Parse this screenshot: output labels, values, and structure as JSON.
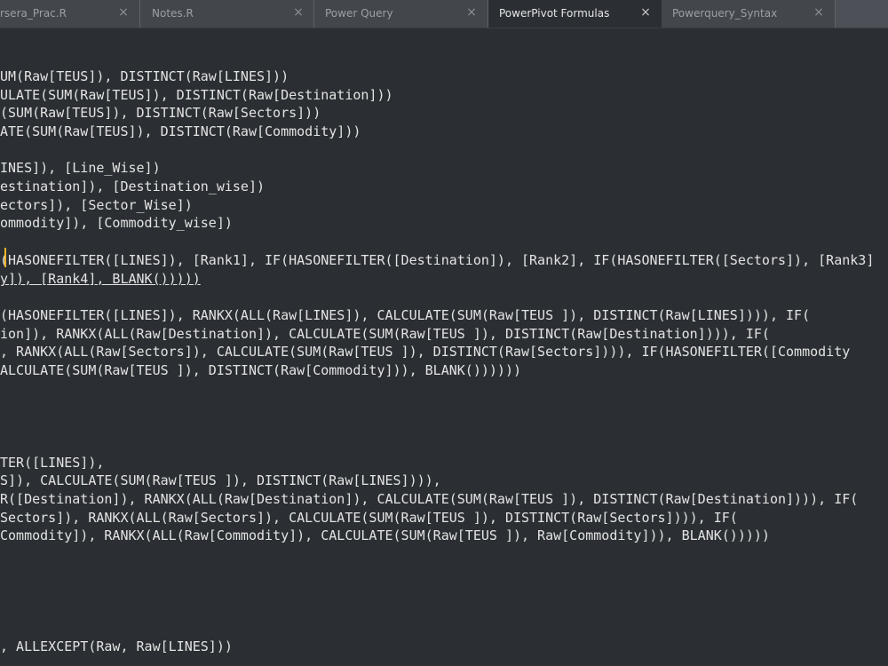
{
  "tabs": [
    {
      "label": "rsera_Prac.R",
      "close": "×",
      "active": false
    },
    {
      "label": "Notes.R",
      "close": "×",
      "active": false
    },
    {
      "label": "Power Query",
      "close": "×",
      "active": false
    },
    {
      "label": "PowerPivot Formulas",
      "close": "×",
      "active": true
    },
    {
      "label": "Powerquery_Syntax",
      "close": "×",
      "active": false
    }
  ],
  "editor": {
    "lines": [
      "UM(Raw[TEUS]), DISTINCT(Raw[LINES]))",
      "ULATE(SUM(Raw[TEUS]), DISTINCT(Raw[Destination]))",
      "(SUM(Raw[TEUS]), DISTINCT(Raw[Sectors]))",
      "ATE(SUM(Raw[TEUS]), DISTINCT(Raw[Commodity]))",
      "",
      "INES]), [Line_Wise])",
      "estination]), [Destination_wise])",
      "ectors]), [Sector_Wise])",
      "ommodity]), [Commodity_wise])",
      "",
      "(HASONEFILTER([LINES]), [Rank1], IF(HASONEFILTER([Destination]), [Rank2], IF(HASONEFILTER([Sectors]), [Rank3]",
      "y]), [Rank4], BLANK()))))",
      "",
      "(HASONEFILTER([LINES]), RANKX(ALL(Raw[LINES]), CALCULATE(SUM(Raw[TEUS ]), DISTINCT(Raw[LINES]))), IF(",
      "ion]), RANKX(ALL(Raw[Destination]), CALCULATE(SUM(Raw[TEUS ]), DISTINCT(Raw[Destination]))), IF(",
      ", RANKX(ALL(Raw[Sectors]), CALCULATE(SUM(Raw[TEUS ]), DISTINCT(Raw[Sectors]))), IF(HASONEFILTER([Commodity",
      "ALCULATE(SUM(Raw[TEUS ]), DISTINCT(Raw[Commodity])), BLANK())))))",
      "",
      "",
      "",
      "",
      "TER([LINES]),",
      "S]), CALCULATE(SUM(Raw[TEUS ]), DISTINCT(Raw[LINES]))),",
      "R([Destination]), RANKX(ALL(Raw[Destination]), CALCULATE(SUM(Raw[TEUS ]), DISTINCT(Raw[Destination]))), IF(",
      "Sectors]), RANKX(ALL(Raw[Sectors]), CALCULATE(SUM(Raw[TEUS ]), DISTINCT(Raw[Sectors]))), IF(",
      "Commodity]), RANKX(ALL(Raw[Commodity]), CALCULATE(SUM(Raw[TEUS ]), Raw[Commodity])), BLANK()))))",
      "",
      "",
      "",
      "",
      "",
      ", ALLEXCEPT(Raw, Raw[LINES]))"
    ]
  }
}
